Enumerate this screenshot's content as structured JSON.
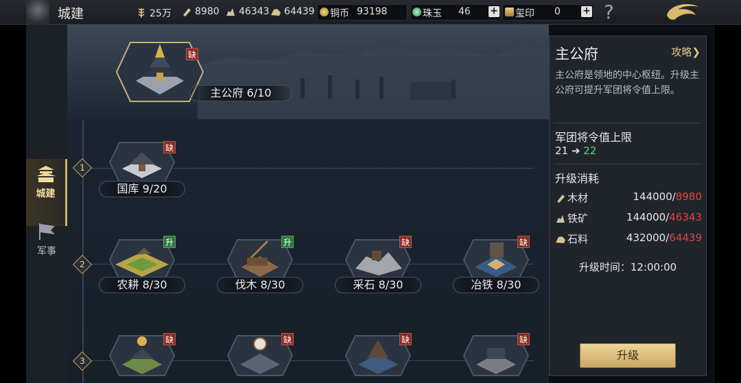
{
  "header": {
    "title": "城建",
    "resources": [
      {
        "icon": "grain-icon",
        "value": "25万"
      },
      {
        "icon": "wood-icon",
        "value": "8980"
      },
      {
        "icon": "iron-ore-icon",
        "value": "46343"
      },
      {
        "icon": "stone-icon",
        "value": "64439"
      }
    ],
    "copper": {
      "label": "铜币",
      "value": "93198"
    },
    "jade": {
      "label": "珠玉",
      "value": "46"
    },
    "seal": {
      "label": "玺印",
      "value": "0"
    },
    "help": "?"
  },
  "nav": {
    "city": "城建",
    "military": "军事"
  },
  "main_building": {
    "name": "主公府 6/10",
    "badge": "缺"
  },
  "tiers": [
    "1",
    "2",
    "3"
  ],
  "buildings": [
    {
      "name": "国库 9/20",
      "badge": "缺",
      "badge_color": "#8d2b22"
    },
    {
      "name": "农耕 8/30",
      "badge": "升",
      "badge_color": "#2d7a3a"
    },
    {
      "name": "伐木 8/30",
      "badge": "升",
      "badge_color": "#2d7a3a"
    },
    {
      "name": "采石 8/30",
      "badge": "缺",
      "badge_color": "#8d2b22"
    },
    {
      "name": "冶铁 8/30",
      "badge": "缺",
      "badge_color": "#8d2b22"
    },
    {
      "name": "",
      "badge": "缺",
      "badge_color": "#8d2b22"
    },
    {
      "name": "",
      "badge": "缺",
      "badge_color": "#8d2b22"
    },
    {
      "name": "",
      "badge": "缺",
      "badge_color": "#8d2b22"
    },
    {
      "name": "",
      "badge": "缺",
      "badge_color": "#8d2b22"
    }
  ],
  "panel": {
    "title": "主公府",
    "guide": "攻略",
    "description": "主公府是领地的中心枢纽。升级主公府可提升军团将令值上限。",
    "limit_title": "军团将令值上限",
    "limit_old": "21",
    "limit_new": "22",
    "cost_title": "升级消耗",
    "costs": [
      {
        "icon": "wood-icon",
        "name": "木材",
        "need": "144000",
        "have": "8980"
      },
      {
        "icon": "iron-ore-icon",
        "name": "铁矿",
        "need": "144000",
        "have": "46343"
      },
      {
        "icon": "stone-icon",
        "name": "石料",
        "need": "432000",
        "have": "64439"
      }
    ],
    "upgrade_time": "升级时间：12:00:00",
    "upgrade_button": "升级"
  },
  "colors": {
    "accent_gold": "#d3b15d",
    "insufficient": "#e0443a",
    "increase": "#5fd47a"
  }
}
